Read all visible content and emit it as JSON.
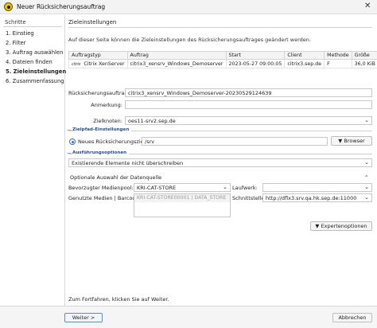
{
  "window": {
    "title": "Neuer Rücksicherungsauftrag",
    "close_glyph": "✕"
  },
  "sidebar": {
    "heading": "Schritte",
    "items": [
      {
        "label": "1. Einstieg",
        "active": false
      },
      {
        "label": "2. Filter",
        "active": false
      },
      {
        "label": "3. Auftrag auswählen",
        "active": false
      },
      {
        "label": "4. Dateien finden",
        "active": false
      },
      {
        "label": "5. Zieleinstellungen",
        "active": true
      },
      {
        "label": "6. Zusammenfassung",
        "active": false
      }
    ]
  },
  "main": {
    "title": "Zieleinstellungen",
    "intro": "Auf dieser Seite können die Zieleinstellungen des Rücksicherungsauftrages geändert werden.",
    "table": {
      "headers": [
        "Auftragstyp",
        "Auftrag",
        "Start",
        "Client",
        "Methode",
        "Größe"
      ],
      "row": {
        "logo": "citrix",
        "type": "Citrix XenServer",
        "job": "citrix3_xensrv_Windows_Demoserver",
        "start": "2023-05-27 09:00:05",
        "client": "citrix3.sep.de",
        "method": "F",
        "size": "36,0 KiB"
      }
    },
    "form": {
      "restore_job_label": "Rücksicherungsauftrag:",
      "restore_job_value": "citrix3_xensrv_Windows_Demoserver-20230529124639",
      "comment_label": "Anmerkung:",
      "comment_value": "",
      "target_node_label": "Zielknoten:",
      "target_node_value": "oes11-srv2.sep.de"
    },
    "target_path": {
      "section_label": "Zielpfad-Einstellungen",
      "radio_label": "Neues Rücksicherungsziel",
      "path_value": "/srv",
      "browse_label": "Browser"
    },
    "execution": {
      "section_label": "Ausführungsoptionen",
      "overwrite_value": "Existierende Elemente nicht überschreiben"
    },
    "data_source": {
      "heading": "Optionale Auswahl der Datenquelle",
      "media_pool_label": "Bevorzugter Medienpool:",
      "media_pool_value": "KRI-CAT-STORE",
      "drive_label": "Laufwerk:",
      "drive_value": "",
      "media_label": "Genutzte Medien | Barcode:",
      "media_item": "KRI-CAT-STORE00001 | DATA_STORE",
      "interface_label": "Schnittstelle:",
      "interface_value": "http://dflx3.srv.qa.hk.sep.de:11000",
      "expert_label": "Expertenoptionen"
    },
    "hint": "Zum Fortfahren, klicken Sie auf Weiter."
  },
  "footer": {
    "next_label": "Weiter >",
    "cancel_label": "Abbrechen"
  }
}
